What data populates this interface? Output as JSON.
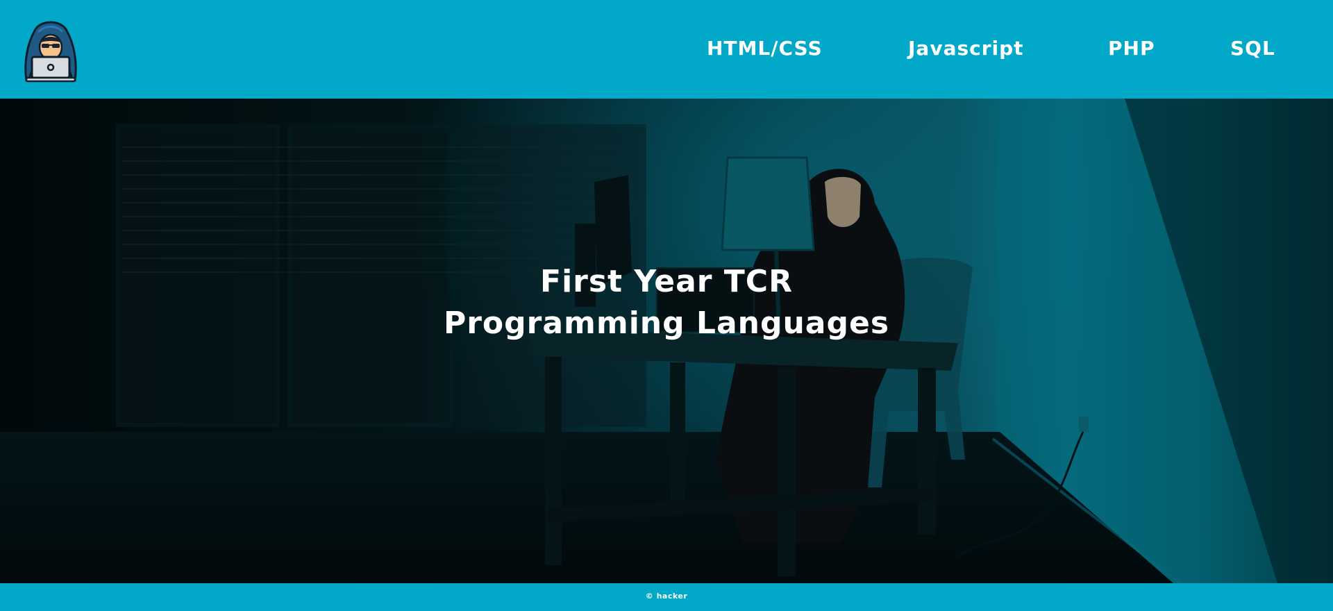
{
  "header": {
    "logo_icon": "hacker-laptop-icon",
    "background_color": "#02a8c8",
    "nav": [
      {
        "label": "HTML/CSS"
      },
      {
        "label": "Javascript"
      },
      {
        "label": "PHP"
      },
      {
        "label": "SQL"
      }
    ]
  },
  "hero": {
    "image": "hooded-hacker-at-desk-photo",
    "title_line1": "First Year TCR",
    "title_line2": "Programming Languages"
  },
  "footer": {
    "text": "© hacker"
  }
}
